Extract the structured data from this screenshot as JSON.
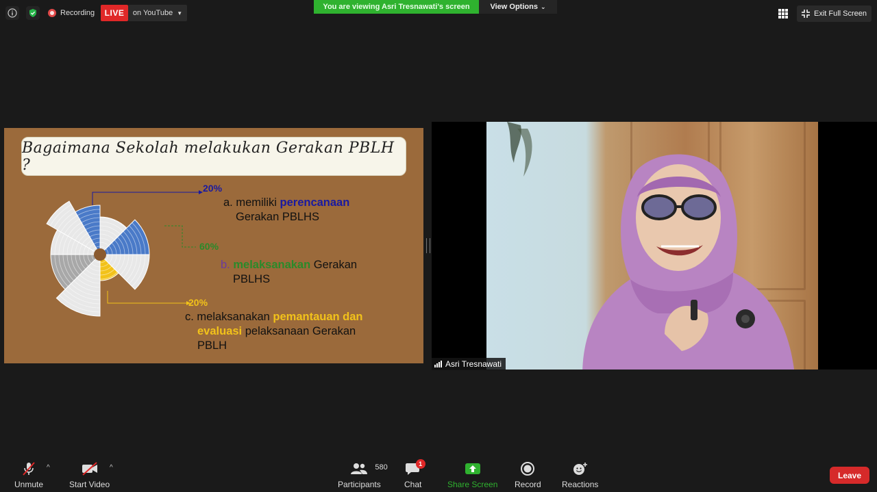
{
  "topbar": {
    "recording_label": "Recording",
    "live_label": "LIVE",
    "youtube_label": "on YouTube",
    "viewing_banner": "You are viewing Asri Tresnawati's screen",
    "view_options_label": "View Options",
    "exit_fullscreen_label": "Exit Full Screen"
  },
  "slide": {
    "title": "Bagaimana Sekolah melakukan Gerakan PBLH ?",
    "item_a": {
      "percent": "20%",
      "prefix": "a. memiliki ",
      "highlight": "perencanaan",
      "line2": "Gerakan PBLHS",
      "percent_color": "#1a1aa0",
      "highlight_color": "#1a1aa0"
    },
    "item_b": {
      "percent": "60%",
      "prefix": "b. ",
      "highlight": "melaksanakan",
      "suffix": " Gerakan",
      "line2": "PBLHS",
      "percent_color": "#2a8a2a",
      "highlight_color": "#2a8a2a",
      "prefix_color": "#6a3aa0"
    },
    "item_c": {
      "percent": "20%",
      "prefix": "c. melaksanakan ",
      "highlight1": "pemantauan dan",
      "highlight2": "evaluasi",
      "suffix": " pelaksanaan Gerakan",
      "line3": "PBLH",
      "percent_color": "#f2c21a",
      "highlight_color": "#f2c21a"
    }
  },
  "video": {
    "participant_name": "Asri Tresnawati"
  },
  "toolbar": {
    "unmute_label": "Unmute",
    "start_video_label": "Start Video",
    "participants_label": "Participants",
    "participants_count": "580",
    "chat_label": "Chat",
    "chat_badge": "1",
    "share_label": "Share Screen",
    "record_label": "Record",
    "reactions_label": "Reactions",
    "leave_label": "Leave"
  },
  "colors": {
    "share_green": "#2fb22f",
    "live_red": "#e02828",
    "leave_red": "#d62a2a",
    "slide_bg": "#9b6a3b",
    "chart_blue": "#4a7ac8",
    "chart_gray": "#a8a8a8",
    "chart_white": "#e8e8e8",
    "chart_yellow": "#f2c21a"
  }
}
